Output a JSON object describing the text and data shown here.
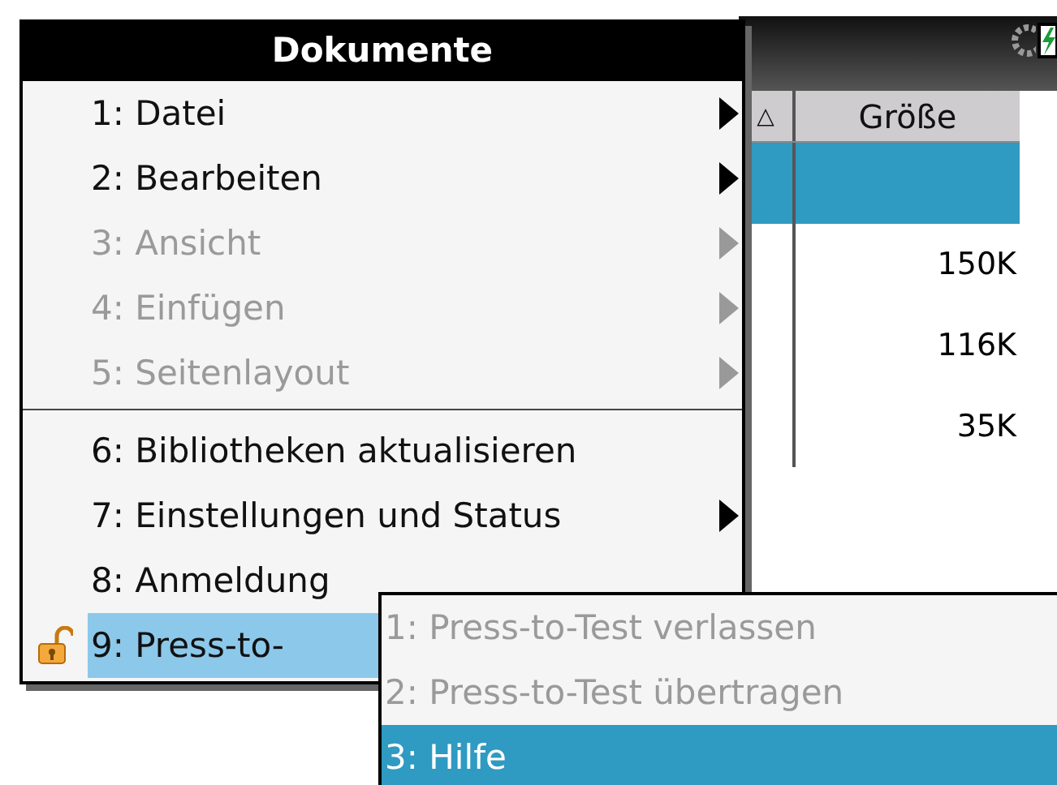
{
  "background": {
    "table": {
      "columns": [
        {
          "label": "△"
        },
        {
          "label": "Größe"
        }
      ],
      "rows": [
        {
          "size": null,
          "selected": true
        },
        {
          "size": "150K",
          "selected": false
        },
        {
          "size": "116K",
          "selected": false
        },
        {
          "size": "35K",
          "selected": false
        }
      ]
    }
  },
  "menu": {
    "title": "Dokumente",
    "groups": [
      [
        {
          "label": "1: Datei",
          "disabled": false,
          "has_submenu": true,
          "selected": false,
          "kind": "plain"
        },
        {
          "label": "2: Bearbeiten",
          "disabled": false,
          "has_submenu": true,
          "selected": false,
          "kind": "plain"
        },
        {
          "label": "3: Ansicht",
          "disabled": true,
          "has_submenu": true,
          "selected": false,
          "kind": "plain"
        },
        {
          "label": "4: Einfügen",
          "disabled": true,
          "has_submenu": true,
          "selected": false,
          "kind": "plain"
        },
        {
          "label": "5: Seitenlayout",
          "disabled": true,
          "has_submenu": true,
          "selected": false,
          "kind": "plain"
        }
      ],
      [
        {
          "label": "6: Bibliotheken aktualisieren",
          "disabled": false,
          "has_submenu": false,
          "selected": false,
          "kind": "plain"
        },
        {
          "label": "7: Einstellungen und Status",
          "disabled": false,
          "has_submenu": true,
          "selected": false,
          "kind": "plain"
        },
        {
          "label": "8: Anmeldung",
          "disabled": false,
          "has_submenu": false,
          "selected": false,
          "kind": "plain"
        },
        {
          "label": "9: Press-to-",
          "disabled": false,
          "has_submenu": false,
          "selected": true,
          "kind": "locked"
        }
      ]
    ]
  },
  "submenu": {
    "items": [
      {
        "label": "1: Press-to-Test verlassen",
        "disabled": true,
        "selected": false
      },
      {
        "label": "2: Press-to-Test übertragen",
        "disabled": true,
        "selected": false
      },
      {
        "label": "3: Hilfe",
        "disabled": false,
        "selected": true
      }
    ]
  }
}
